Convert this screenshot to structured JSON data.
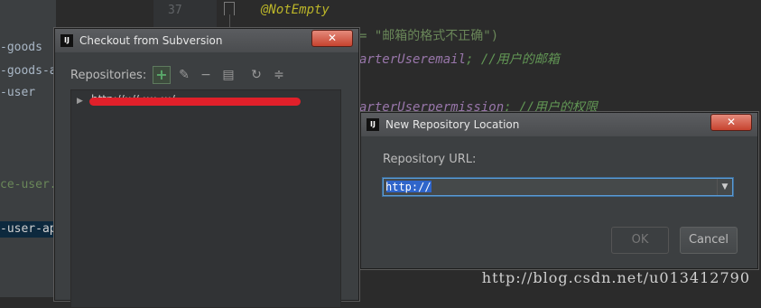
{
  "project_tree": {
    "items": [
      {
        "label": "-goods",
        "top": 0
      },
      {
        "label": "-goods-a",
        "top": 0
      },
      {
        "label": "-user",
        "top": 0
      },
      {
        "label": "ce-user.in",
        "top": 0
      },
      {
        "label": "-user-ap",
        "top": 0
      }
    ]
  },
  "editor": {
    "line_number": "37",
    "annotation": "@NotEmpty",
    "line2_suffix": "= \"邮箱的格式不正确\")",
    "line3_field": "arterUseremail",
    "line3_comment": "; //用户的邮箱",
    "line4_field": "arterUserpermission",
    "line4_comment": "; //用户的权限"
  },
  "checkout_window": {
    "title": "Checkout from Subversion",
    "close_label": "✕",
    "repositories_label": "Repositories:",
    "toolbar": {
      "add": "+",
      "edit": "✎",
      "remove": "−",
      "browse": "▤",
      "refresh": "↻",
      "collapse": "≑"
    },
    "repo_entry": "http://:://.::::.:::/..."
  },
  "new_repo_dialog": {
    "title": "New Repository Location",
    "close_label": "✕",
    "url_label": "Repository URL:",
    "url_value": "http://",
    "ok_label": "OK",
    "cancel_label": "Cancel"
  },
  "watermark": "http://blog.csdn.net/u013412790",
  "app_logo_text": "IJ"
}
